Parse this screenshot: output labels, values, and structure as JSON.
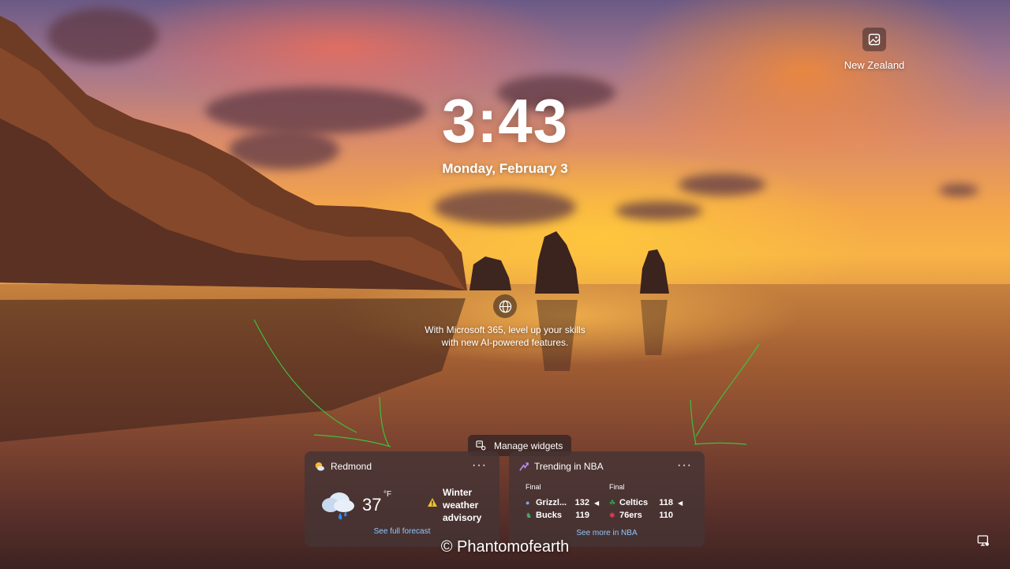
{
  "lock_screen": {
    "time": "3:43",
    "date": "Monday, February 3"
  },
  "spotlight": {
    "label": "New Zealand",
    "icon": "image-icon"
  },
  "promo": {
    "icon": "globe-icon",
    "line1": "With Microsoft 365, level up your skills",
    "line2": "with new AI-powered features."
  },
  "widgets_bar": {
    "manage_label": "Manage widgets"
  },
  "weather_widget": {
    "location": "Redmond",
    "temperature": "37",
    "unit": "°F",
    "condition_icon": "rain-cloud-icon",
    "advisory": "Winter weather advisory",
    "link": "See full forecast",
    "more": "···"
  },
  "nba_widget": {
    "title": "Trending in NBA",
    "more": "···",
    "games": [
      {
        "status": "Final",
        "teams": [
          {
            "name": "Grizzl...",
            "score": "132",
            "winner": true
          },
          {
            "name": "Bucks",
            "score": "119",
            "winner": false
          }
        ]
      },
      {
        "status": "Final",
        "teams": [
          {
            "name": "Celtics",
            "score": "118",
            "winner": true
          },
          {
            "name": "76ers",
            "score": "110",
            "winner": false
          }
        ]
      }
    ],
    "link": "See more in NBA"
  },
  "watermark": "© Phantomofearth",
  "colors": {
    "link": "#8cc8ff",
    "widget_bg": "#463434",
    "annotation": "#3fbf3f",
    "advisory": "#f2c230"
  }
}
